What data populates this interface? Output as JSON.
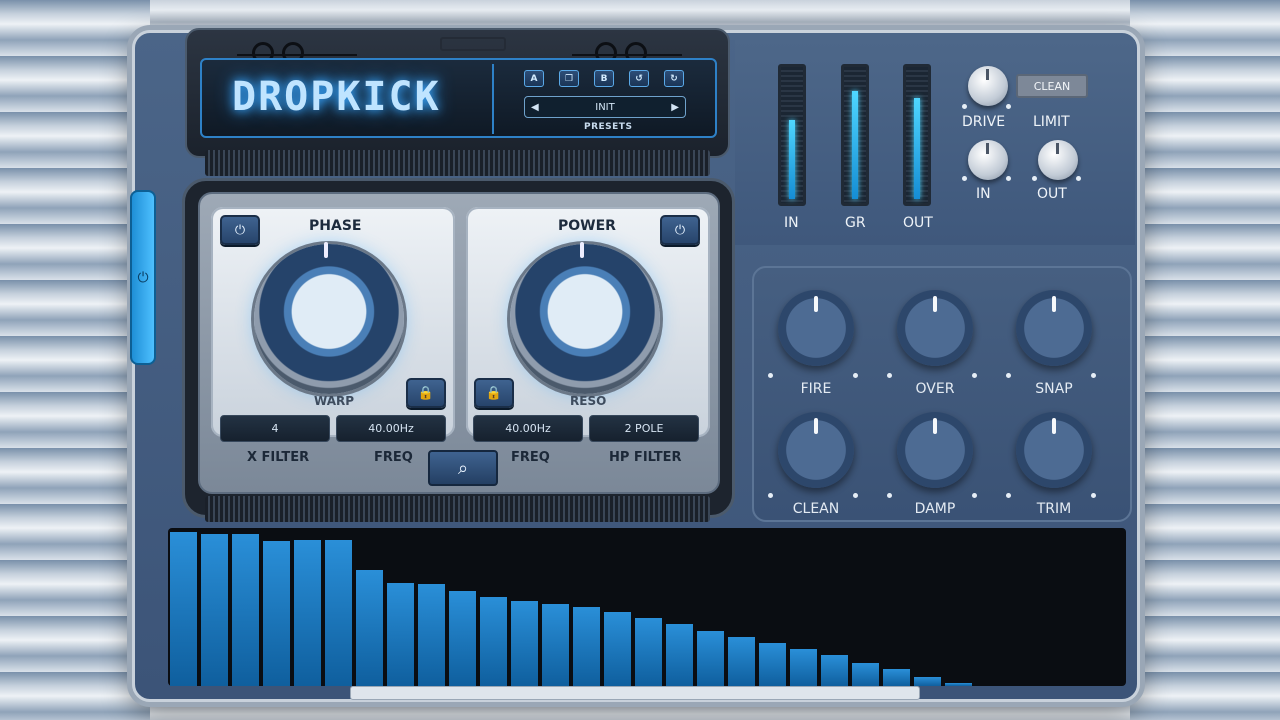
{
  "plugin": {
    "title": "DROPKICK",
    "accent_color": "#2a9be8"
  },
  "presets": {
    "buttons": [
      "A",
      "copy-icon",
      "B",
      "undo-icon",
      "redo-icon"
    ],
    "button_labels": {
      "a": "A",
      "b": "B"
    },
    "current": "INIT",
    "label": "PRESETS",
    "prev_arrow": "◀",
    "next_arrow": "▶"
  },
  "left_module": {
    "title": "PHASE",
    "sub_label": "WARP",
    "field_value": "4",
    "field_label": "X FILTER",
    "freq_value": "40.00Hz",
    "freq_label": "FREQ"
  },
  "right_module": {
    "title": "POWER",
    "sub_label": "RESO",
    "freq_value": "40.00Hz",
    "freq_label": "FREQ",
    "filter_value": "2 POLE",
    "filter_label": "HP FILTER"
  },
  "meters": [
    {
      "label": "IN",
      "level": 0.62
    },
    {
      "label": "GR",
      "level": 0.84
    },
    {
      "label": "OUT",
      "level": 0.79
    }
  ],
  "controls": {
    "drive": "DRIVE",
    "limit": "LIMIT",
    "in": "IN",
    "out": "OUT",
    "clean_button": "CLEAN"
  },
  "knobs": [
    {
      "label": "FIRE"
    },
    {
      "label": "OVER"
    },
    {
      "label": "SNAP"
    },
    {
      "label": "CLEAN"
    },
    {
      "label": "DAMP"
    },
    {
      "label": "TRIM"
    }
  ],
  "spectrum": {
    "levels": [
      1.0,
      0.99,
      0.99,
      0.94,
      0.95,
      0.95,
      0.75,
      0.67,
      0.66,
      0.62,
      0.58,
      0.55,
      0.53,
      0.51,
      0.48,
      0.44,
      0.4,
      0.36,
      0.32,
      0.28,
      0.24,
      0.2,
      0.15,
      0.11,
      0.06,
      0.02
    ]
  }
}
